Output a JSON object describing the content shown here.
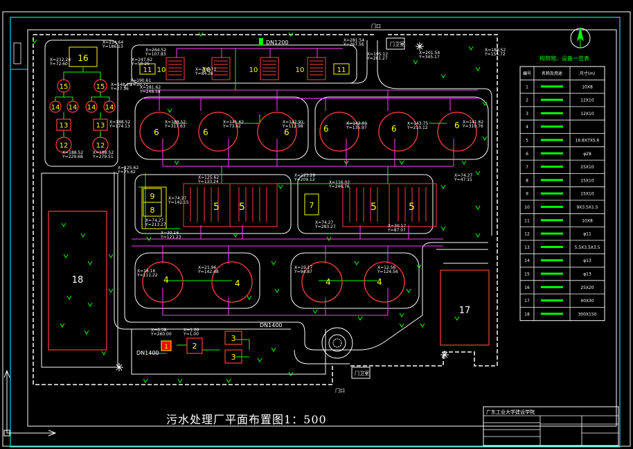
{
  "drawing_title": "污水处理厂平面布置图1：500",
  "school_name": "广东工业大学建设学院",
  "legend": {
    "title": "构筑物、设备一览表",
    "headers": [
      "编号",
      "名称及用途",
      "尺寸(m)"
    ],
    "rows": [
      {
        "no": "1",
        "size": "10X8"
      },
      {
        "no": "2",
        "size": "12X10"
      },
      {
        "no": "3",
        "size": "12X10"
      },
      {
        "no": "4",
        "size": ""
      },
      {
        "no": "5",
        "size": "16.8X7X5.6"
      },
      {
        "no": "6",
        "size": "φ28"
      },
      {
        "no": "7",
        "size": "25X10"
      },
      {
        "no": "8",
        "size": "15X10"
      },
      {
        "no": "9",
        "size": "15X10"
      },
      {
        "no": "10",
        "size": "9X3.5X1.5"
      },
      {
        "no": "11",
        "size": "10X8"
      },
      {
        "no": "12",
        "size": "φ11"
      },
      {
        "no": "13",
        "size": "5.5X3.5X3.5"
      },
      {
        "no": "14",
        "size": "φ13"
      },
      {
        "no": "15",
        "size": "φ13"
      },
      {
        "no": "16",
        "size": "25X20"
      },
      {
        "no": "17",
        "size": "40X30"
      },
      {
        "no": "18",
        "size": "300X150"
      }
    ]
  },
  "labels": {
    "gate_top": "门口",
    "gate_bottom": "门口",
    "guard_top": "门卫室",
    "guard_bottom": "门卫室",
    "dn1200": "DN1200",
    "dn1400_a": "DN1400",
    "dn1400_b": "DN1400"
  },
  "units": [
    {
      "id": "u16",
      "label": "16"
    },
    {
      "id": "u15a",
      "label": "15"
    },
    {
      "id": "u15b",
      "label": "15"
    },
    {
      "id": "u14a",
      "label": "14"
    },
    {
      "id": "u14b",
      "label": "14"
    },
    {
      "id": "u14c",
      "label": "14"
    },
    {
      "id": "u14d",
      "label": "14"
    },
    {
      "id": "u13a",
      "label": "13"
    },
    {
      "id": "u13b",
      "label": "13"
    },
    {
      "id": "u12a",
      "label": "12"
    },
    {
      "id": "u12b",
      "label": "12"
    },
    {
      "id": "u11a",
      "label": "11"
    },
    {
      "id": "u11b",
      "label": "11"
    },
    {
      "id": "u10a",
      "label": "10"
    },
    {
      "id": "u10b",
      "label": "10"
    },
    {
      "id": "u10c",
      "label": "10"
    },
    {
      "id": "u10d",
      "label": "10"
    },
    {
      "id": "u6a",
      "label": "6"
    },
    {
      "id": "u6b",
      "label": "6"
    },
    {
      "id": "u6c",
      "label": "6"
    },
    {
      "id": "u6d",
      "label": "6"
    },
    {
      "id": "u6e",
      "label": "6"
    },
    {
      "id": "u6f",
      "label": "6"
    },
    {
      "id": "u9",
      "label": "9"
    },
    {
      "id": "u8",
      "label": "8"
    },
    {
      "id": "u7",
      "label": "7"
    },
    {
      "id": "u5a",
      "label": "5"
    },
    {
      "id": "u5b",
      "label": "5"
    },
    {
      "id": "u5c",
      "label": "5"
    },
    {
      "id": "u5d",
      "label": "5"
    },
    {
      "id": "u4a",
      "label": "4"
    },
    {
      "id": "u4b",
      "label": "4"
    },
    {
      "id": "u4c",
      "label": "4"
    },
    {
      "id": "u4d",
      "label": "4"
    },
    {
      "id": "u18",
      "label": "18"
    },
    {
      "id": "u17",
      "label": "17"
    },
    {
      "id": "u3a",
      "label": "3"
    },
    {
      "id": "u3b",
      "label": "3"
    },
    {
      "id": "u2",
      "label": "2"
    },
    {
      "id": "u1",
      "label": "1"
    }
  ],
  "coords": [
    "X=254.64",
    "Y=186.13",
    "X=212.24",
    "Y=72.60",
    "X=247.62",
    "Y=59.25",
    "X=190.61",
    "Y=30.71",
    "X=148.25",
    "Y=27.36",
    "X=264.52",
    "Y=107.83",
    "X=209.71",
    "Y=84.26",
    "X=281.62",
    "Y=248.58",
    "X=281.54",
    "Y=267.56",
    "X=195.12",
    "Y=281.27",
    "X=201.54",
    "Y=345.17",
    "X=188.52",
    "Y=154.72",
    "X=188.52",
    "Y=174.13",
    "X=188.52",
    "Y=229.68",
    "X=188.52",
    "Y=279.51",
    "X=188.52",
    "Y=317.63",
    "X=145.62",
    "Y=73.62",
    "X=142.91",
    "Y=112.98",
    "X=142.01",
    "Y=135.97",
    "X=143.75",
    "Y=210.12",
    "X=141.62",
    "Y=310.76",
    "X=125.62",
    "Y=75.62",
    "X=125.62",
    "Y=133.24",
    "X=123.29",
    "Y=209.12",
    "X=116.02",
    "Y=246.76",
    "X=74.27",
    "Y=47.15",
    "X=74.27",
    "Y=142.15",
    "X=74.27",
    "Y=213.27",
    "X=74.27",
    "Y=283.27",
    "X=30.17",
    "Y=87.07",
    "X=30.16",
    "Y=121.23",
    "X=18.16",
    "Y=111.22",
    "X=21.96",
    "Y=142.48",
    "X=19.17",
    "Y=94.87",
    "X=12.56",
    "Y=124.56",
    "X=6.38",
    "Y=260.00",
    "X=1.00",
    "Y=1.00"
  ]
}
